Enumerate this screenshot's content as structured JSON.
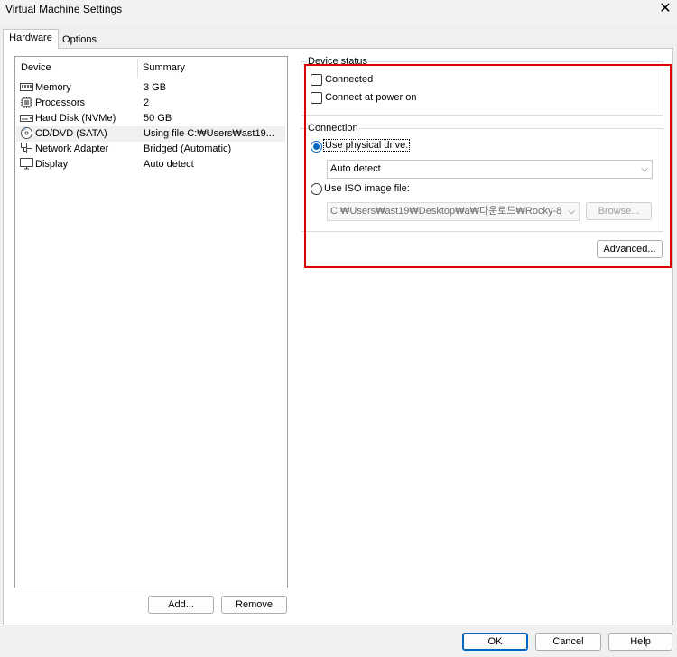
{
  "window": {
    "title": "Virtual Machine Settings",
    "close_symbol": "✕"
  },
  "tabs": [
    {
      "label": "Hardware"
    },
    {
      "label": "Options"
    }
  ],
  "device_list": {
    "columns": {
      "device": "Device",
      "summary": "Summary"
    },
    "rows": [
      {
        "name": "Memory",
        "summary": "3 GB",
        "icon": "memory-icon"
      },
      {
        "name": "Processors",
        "summary": "2",
        "icon": "processor-icon"
      },
      {
        "name": "Hard Disk (NVMe)",
        "summary": "50 GB",
        "icon": "hard-disk-icon"
      },
      {
        "name": "CD/DVD (SATA)",
        "summary": "Using file C:₩Users₩ast19...",
        "icon": "cd-dvd-icon",
        "selected": true
      },
      {
        "name": "Network Adapter",
        "summary": "Bridged (Automatic)",
        "icon": "network-adapter-icon"
      },
      {
        "name": "Display",
        "summary": "Auto detect",
        "icon": "display-icon"
      }
    ],
    "add_label": "Add...",
    "remove_label": "Remove"
  },
  "device_status": {
    "label": "Device status",
    "connected_label": "Connected",
    "connected_checked": false,
    "connect_power_label": "Connect at power on",
    "connect_power_checked": false
  },
  "connection": {
    "label": "Connection",
    "physical_label": "Use physical drive:",
    "physical_selected": true,
    "physical_value": "Auto detect",
    "iso_label": "Use ISO image file:",
    "iso_selected": false,
    "iso_value": "C:₩Users₩ast19₩Desktop₩a₩다운로드₩Rocky-8",
    "browse_label": "Browse..."
  },
  "advanced_label": "Advanced...",
  "footer": {
    "ok": "OK",
    "cancel": "Cancel",
    "help": "Help"
  },
  "colors": {
    "accent": "#0067c0",
    "highlight_box": "#e00000"
  }
}
